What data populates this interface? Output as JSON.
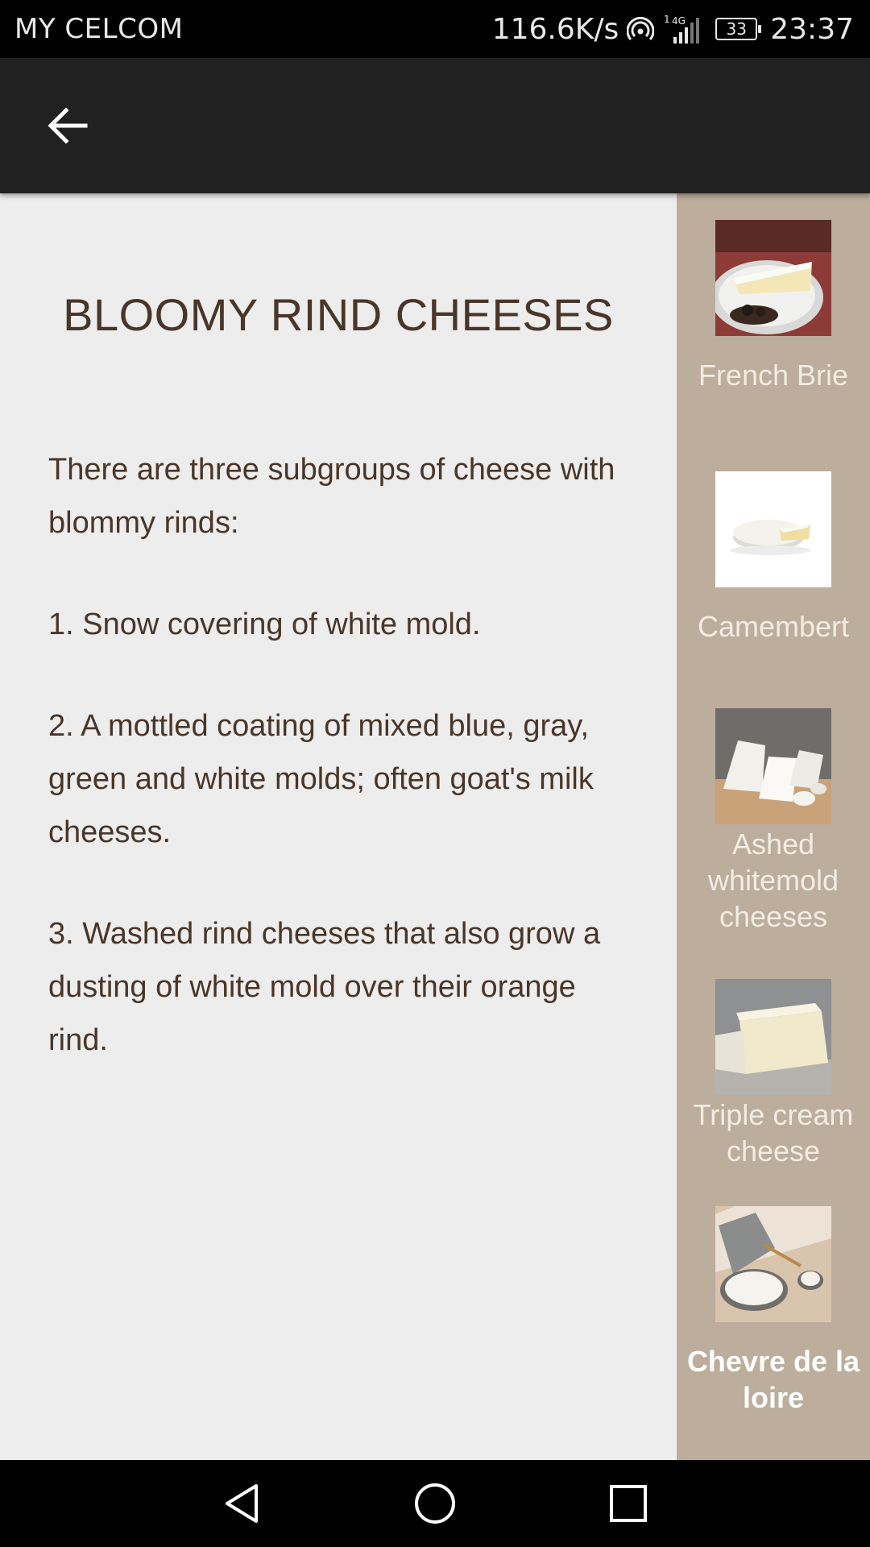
{
  "status_bar": {
    "carrier": "MY CELCOM",
    "network_speed": "116.6K/s",
    "signal_label": "1 4G",
    "battery": "33",
    "time": "23:37"
  },
  "toolbar": {
    "back_icon": "arrow-back-icon"
  },
  "content": {
    "title": "BLOOMY RIND CHEESES",
    "paragraphs": [
      "There are three subgroups of cheese with blommy rinds:",
      "1. Snow covering of white mold.",
      "2. A mottled coating of mixed blue, gray, green and white molds; often goat's milk cheeses.",
      "3. Washed rind cheeses that also grow a dusting of white mold over their orange rind."
    ]
  },
  "side_panel": {
    "items": [
      {
        "label": "French Brie"
      },
      {
        "label": "Camembert"
      },
      {
        "label": "Ashed whitemold cheeses"
      },
      {
        "label": "Triple cream cheese"
      },
      {
        "label": "Chevre de la loire"
      }
    ],
    "selected_index": 4
  },
  "nav_bar": {
    "back": "nav-back-icon",
    "home": "nav-home-icon",
    "recents": "nav-recents-icon"
  },
  "colors": {
    "toolbar": "#212121",
    "content_bg": "#eeeded",
    "side_panel_bg": "#bcad9c",
    "text_brown": "#4a3628"
  }
}
